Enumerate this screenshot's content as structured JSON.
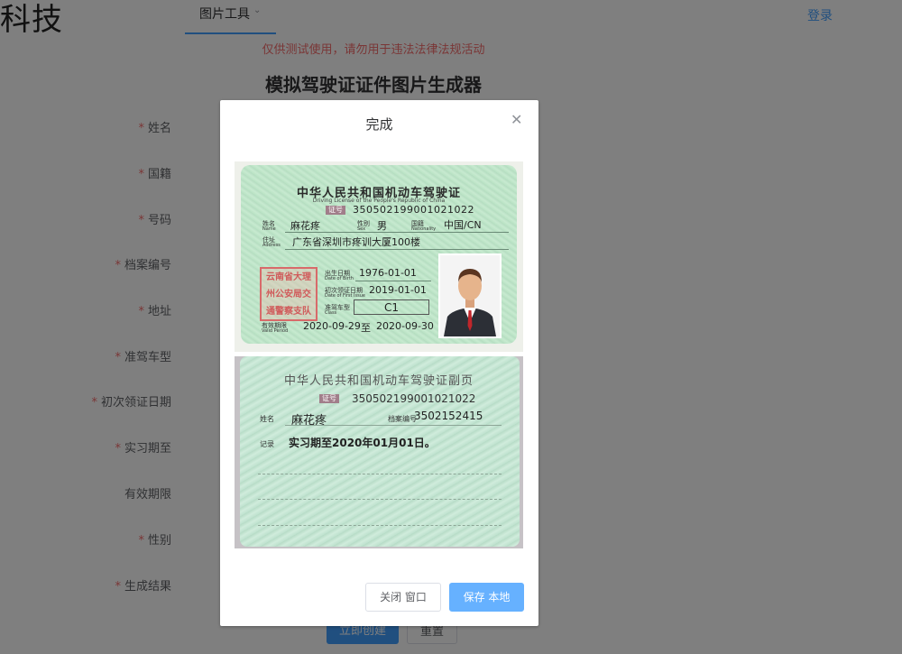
{
  "header": {
    "brand_text": "科技",
    "nav_tab_label": "图片工具",
    "login_label": "登录"
  },
  "warning_text": "仅供测试使用，请勿用于违法法律法规活动",
  "form": {
    "title": "模拟驾驶证证件图片生成器",
    "fields": [
      {
        "label": "姓名",
        "required": true
      },
      {
        "label": "国籍",
        "required": true
      },
      {
        "label": "号码",
        "required": true
      },
      {
        "label": "档案编号",
        "required": true
      },
      {
        "label": "地址",
        "required": true
      },
      {
        "label": "准驾车型",
        "required": true
      },
      {
        "label": "初次领证日期",
        "required": true
      },
      {
        "label": "实习期至",
        "required": true
      },
      {
        "label": "有效期限",
        "required": false
      },
      {
        "label": "性别",
        "required": true
      },
      {
        "label": "生成结果",
        "required": true
      }
    ],
    "create_button": "立即创建",
    "reset_button": "重置"
  },
  "dialog": {
    "title": "完成",
    "close_window_button": "关闭 窗口",
    "save_button": "保存 本地"
  },
  "license_front": {
    "title": "中华人民共和国机动车驾驶证",
    "subtitle": "Driving License of the People's Republic of China",
    "number_tag": "证号",
    "number": "350502199001021022",
    "name_key": "姓名",
    "name_key_en": "Name",
    "name": "麻花疼",
    "sex_key": "性别",
    "sex_key_en": "Sex",
    "sex": "男",
    "nationality_key": "国籍",
    "nationality_key_en": "Nationality",
    "nationality": "中国/CN",
    "address_key": "住址",
    "address_key_en": "Address",
    "address": "广东省深圳市疼训大厦100楼",
    "stamp_lines": [
      "云南省大理",
      "州公安局交",
      "通警察支队"
    ],
    "birth_key": "出生日期",
    "birth_key_en": "Date of Birth",
    "birth": "1976-01-01",
    "first_issue_key": "初次领证日期",
    "first_issue_key_en": "Date of First Issue",
    "first_issue": "2019-01-01",
    "class_key": "准驾车型",
    "class_key_en": "Class",
    "class": "C1",
    "valid_key": "有效期限",
    "valid_key_en": "Valid Period",
    "valid_from": "2020-09-29",
    "valid_to_word": "至",
    "valid_to": "2020-09-30"
  },
  "license_back": {
    "title": "中华人民共和国机动车驾驶证副页",
    "number_tag": "证号",
    "number": "350502199001021022",
    "name_key": "姓名",
    "name": "麻花疼",
    "file_key": "档案编号",
    "file_no": "3502152415",
    "record_key": "记录",
    "record": "实习期至2020年01月01日。"
  }
}
